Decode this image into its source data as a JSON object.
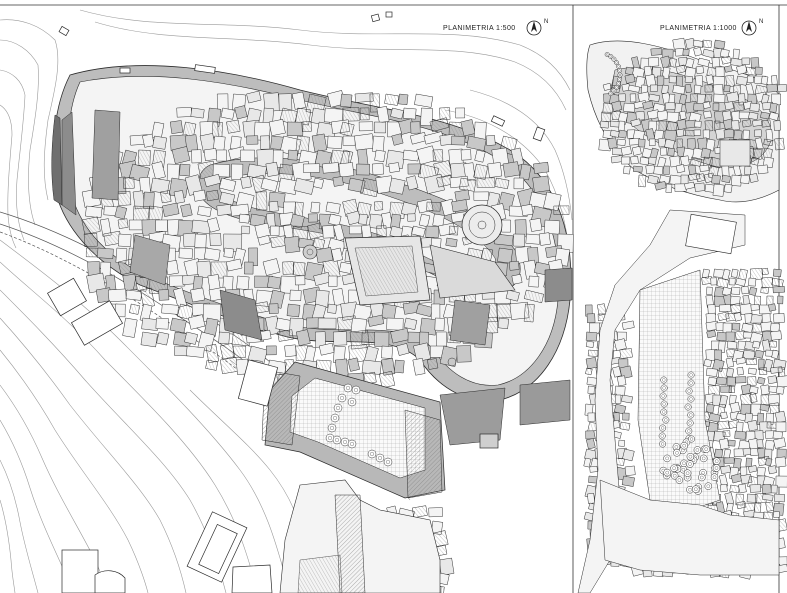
{
  "panels": {
    "main": {
      "title": "PLANIMETRIA 1:500",
      "north_letter": "N"
    },
    "inset": {
      "title": "PLANIMETRIA 1:1000",
      "north_letter": "N"
    }
  },
  "colors": {
    "background": "#ffffff",
    "contour": "#9a9a9a",
    "building_outline": "#2b2b2b",
    "building_fill_light": "#f4f4f4",
    "building_fill_mid": "#c8c8c8",
    "building_fill_dark": "#8c8c8c",
    "street_fill": "#bdbdbd",
    "hatch": "#7a7a7a",
    "frame": "#333333"
  },
  "icons": [
    "north-arrow-icon",
    "tree-icon"
  ]
}
